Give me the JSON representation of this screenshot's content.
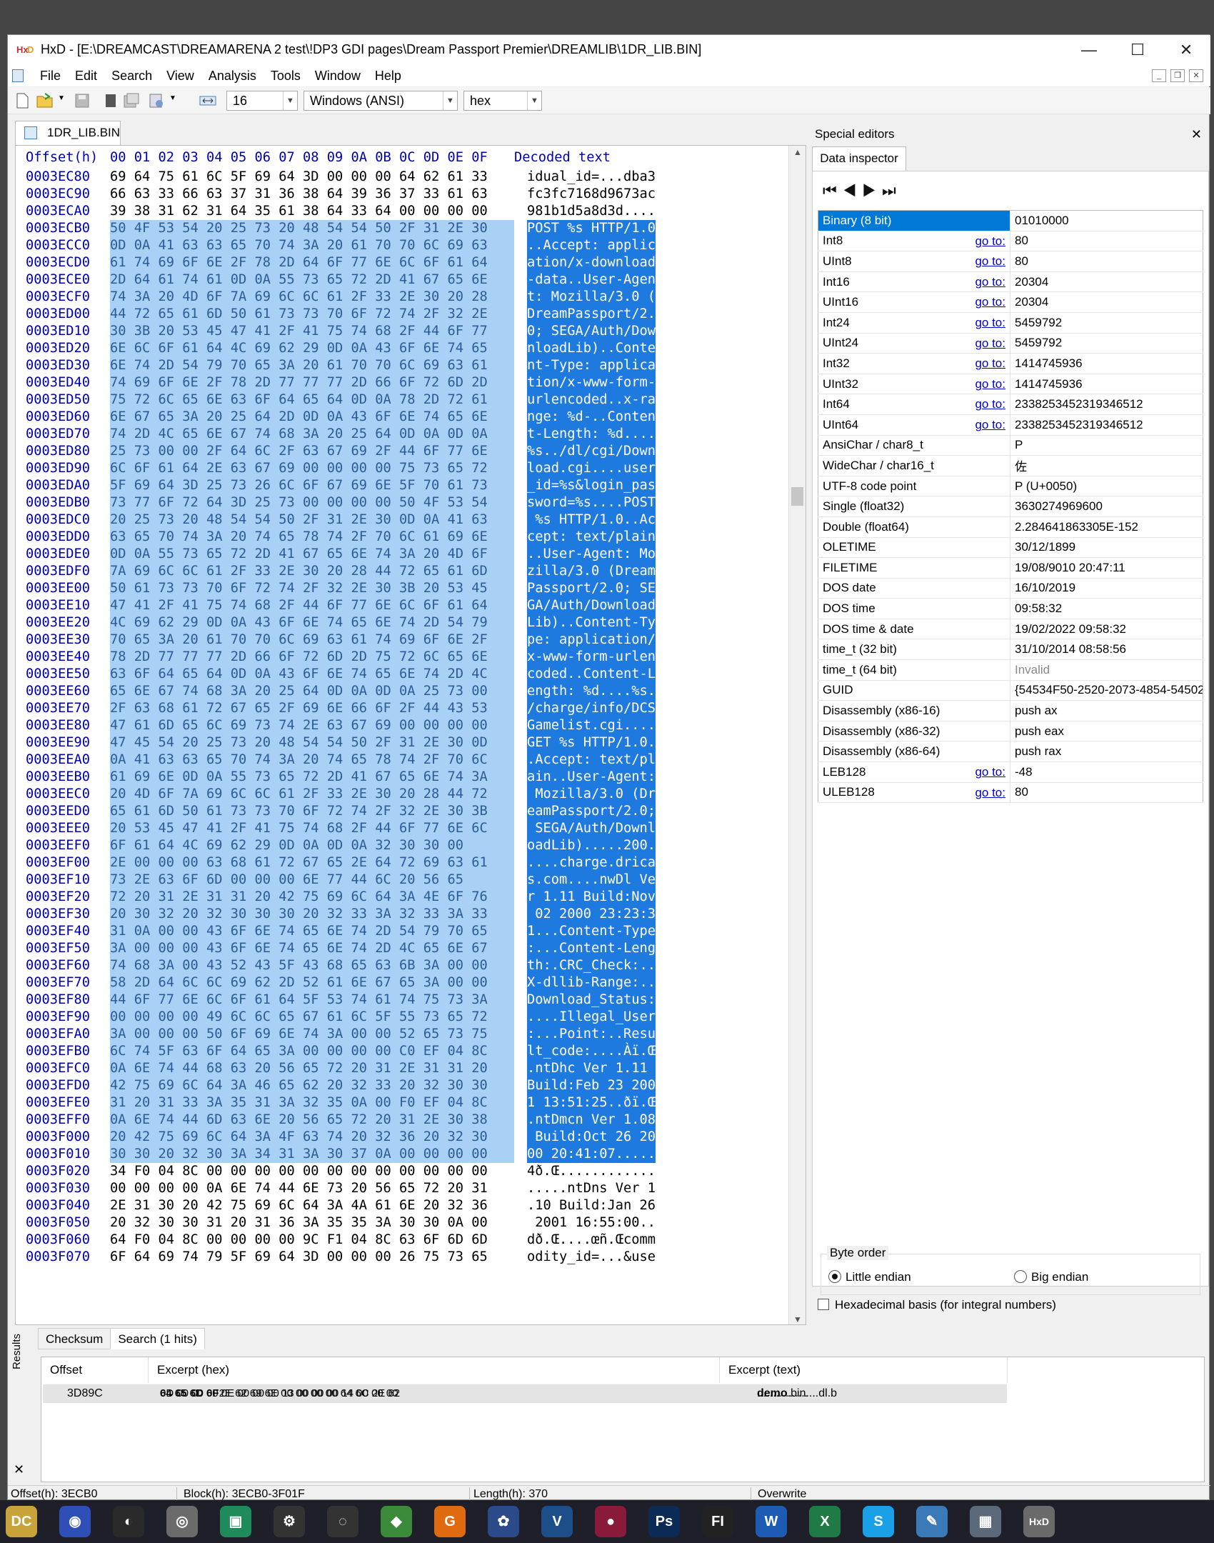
{
  "window": {
    "title": "HxD - [E:\\DREAMCAST\\DREAMARENA 2 test\\!DP3 GDI pages\\Dream Passport Premier\\DREAMLIB\\1DR_LIB.BIN]",
    "minimize_glyph": "—",
    "maximize_glyph": "☐",
    "close_glyph": "✕"
  },
  "menu": [
    "File",
    "Edit",
    "Search",
    "View",
    "Analysis",
    "Tools",
    "Window",
    "Help"
  ],
  "toolbar": {
    "bytes_per_row": "16",
    "charset": "Windows (ANSI)",
    "offset_base": "hex"
  },
  "document_tab": "1DR_LIB.BIN",
  "hex": {
    "header_offset": "Offset(h)",
    "header_columns": "00 01 02 03 04 05 06 07 08 09 0A 0B 0C 0D 0E 0F",
    "header_decoded": "Decoded text",
    "rows": [
      {
        "o": "0003EC80",
        "h": "69 64 75 61 6C 5F 69 64 3D 00 00 00 64 62 61 33",
        "t": "idual_id=...dba3",
        "s": false
      },
      {
        "o": "0003EC90",
        "h": "66 63 33 66 63 37 31 36 38 64 39 36 37 33 61 63",
        "t": "fc3fc7168d9673ac",
        "s": false
      },
      {
        "o": "0003ECA0",
        "h": "39 38 31 62 31 64 35 61 38 64 33 64 00 00 00 00",
        "t": "981b1d5a8d3d....",
        "s": false
      },
      {
        "o": "0003ECB0",
        "h": "50 4F 53 54 20 25 73 20 48 54 54 50 2F 31 2E 30",
        "t": "POST %s HTTP/1.0",
        "s": true
      },
      {
        "o": "0003ECC0",
        "h": "0D 0A 41 63 63 65 70 74 3A 20 61 70 70 6C 69 63",
        "t": "..Accept: applic",
        "s": true
      },
      {
        "o": "0003ECD0",
        "h": "61 74 69 6F 6E 2F 78 2D 64 6F 77 6E 6C 6F 61 64",
        "t": "ation/x-download",
        "s": true
      },
      {
        "o": "0003ECE0",
        "h": "2D 64 61 74 61 0D 0A 55 73 65 72 2D 41 67 65 6E",
        "t": "-data..User-Agen",
        "s": true
      },
      {
        "o": "0003ECF0",
        "h": "74 3A 20 4D 6F 7A 69 6C 6C 61 2F 33 2E 30 20 28",
        "t": "t: Mozilla/3.0 (",
        "s": true
      },
      {
        "o": "0003ED00",
        "h": "44 72 65 61 6D 50 61 73 73 70 6F 72 74 2F 32 2E",
        "t": "DreamPassport/2.",
        "s": true
      },
      {
        "o": "0003ED10",
        "h": "30 3B 20 53 45 47 41 2F 41 75 74 68 2F 44 6F 77",
        "t": "0; SEGA/Auth/Dow",
        "s": true
      },
      {
        "o": "0003ED20",
        "h": "6E 6C 6F 61 64 4C 69 62 29 0D 0A 43 6F 6E 74 65",
        "t": "nloadLib)..Conte",
        "s": true
      },
      {
        "o": "0003ED30",
        "h": "6E 74 2D 54 79 70 65 3A 20 61 70 70 6C 69 63 61",
        "t": "nt-Type: applica",
        "s": true
      },
      {
        "o": "0003ED40",
        "h": "74 69 6F 6E 2F 78 2D 77 77 77 2D 66 6F 72 6D 2D",
        "t": "tion/x-www-form-",
        "s": true
      },
      {
        "o": "0003ED50",
        "h": "75 72 6C 65 6E 63 6F 64 65 64 0D 0A 78 2D 72 61",
        "t": "urlencoded..x-ra",
        "s": true
      },
      {
        "o": "0003ED60",
        "h": "6E 67 65 3A 20 25 64 2D 0D 0A 43 6F 6E 74 65 6E",
        "t": "nge: %d-..Conten",
        "s": true
      },
      {
        "o": "0003ED70",
        "h": "74 2D 4C 65 6E 67 74 68 3A 20 25 64 0D 0A 0D 0A",
        "t": "t-Length: %d....",
        "s": true
      },
      {
        "o": "0003ED80",
        "h": "25 73 00 00 2F 64 6C 2F 63 67 69 2F 44 6F 77 6E",
        "t": "%s../dl/cgi/Down",
        "s": true
      },
      {
        "o": "0003ED90",
        "h": "6C 6F 61 64 2E 63 67 69 00 00 00 00 75 73 65 72",
        "t": "load.cgi....user",
        "s": true
      },
      {
        "o": "0003EDA0",
        "h": "5F 69 64 3D 25 73 26 6C 6F 67 69 6E 5F 70 61 73",
        "t": "_id=%s&login_pas",
        "s": true
      },
      {
        "o": "0003EDB0",
        "h": "73 77 6F 72 64 3D 25 73 00 00 00 00 50 4F 53 54",
        "t": "sword=%s....POST",
        "s": true
      },
      {
        "o": "0003EDC0",
        "h": "20 25 73 20 48 54 54 50 2F 31 2E 30 0D 0A 41 63",
        "t": " %s HTTP/1.0..Ac",
        "s": true
      },
      {
        "o": "0003EDD0",
        "h": "63 65 70 74 3A 20 74 65 78 74 2F 70 6C 61 69 6E",
        "t": "cept: text/plain",
        "s": true
      },
      {
        "o": "0003EDE0",
        "h": "0D 0A 55 73 65 72 2D 41 67 65 6E 74 3A 20 4D 6F",
        "t": "..User-Agent: Mo",
        "s": true
      },
      {
        "o": "0003EDF0",
        "h": "7A 69 6C 6C 61 2F 33 2E 30 20 28 44 72 65 61 6D",
        "t": "zilla/3.0 (Dream",
        "s": true
      },
      {
        "o": "0003EE00",
        "h": "50 61 73 73 70 6F 72 74 2F 32 2E 30 3B 20 53 45",
        "t": "Passport/2.0; SE",
        "s": true
      },
      {
        "o": "0003EE10",
        "h": "47 41 2F 41 75 74 68 2F 44 6F 77 6E 6C 6F 61 64",
        "t": "GA/Auth/Download",
        "s": true
      },
      {
        "o": "0003EE20",
        "h": "4C 69 62 29 0D 0A 43 6F 6E 74 65 6E 74 2D 54 79",
        "t": "Lib)..Content-Ty",
        "s": true
      },
      {
        "o": "0003EE30",
        "h": "70 65 3A 20 61 70 70 6C 69 63 61 74 69 6F 6E 2F",
        "t": "pe: application/",
        "s": true
      },
      {
        "o": "0003EE40",
        "h": "78 2D 77 77 77 2D 66 6F 72 6D 2D 75 72 6C 65 6E",
        "t": "x-www-form-urlen",
        "s": true
      },
      {
        "o": "0003EE50",
        "h": "63 6F 64 65 64 0D 0A 43 6F 6E 74 65 6E 74 2D 4C",
        "t": "coded..Content-L",
        "s": true
      },
      {
        "o": "0003EE60",
        "h": "65 6E 67 74 68 3A 20 25 64 0D 0A 0D 0A 25 73 00",
        "t": "ength: %d....%s.",
        "s": true
      },
      {
        "o": "0003EE70",
        "h": "2F 63 68 61 72 67 65 2F 69 6E 66 6F 2F 44 43 53",
        "t": "/charge/info/DCS",
        "s": true
      },
      {
        "o": "0003EE80",
        "h": "47 61 6D 65 6C 69 73 74 2E 63 67 69 00 00 00 00",
        "t": "Gamelist.cgi....",
        "s": true
      },
      {
        "o": "0003EE90",
        "h": "47 45 54 20 25 73 20 48 54 54 50 2F 31 2E 30 0D",
        "t": "GET %s HTTP/1.0.",
        "s": true
      },
      {
        "o": "0003EEA0",
        "h": "0A 41 63 63 65 70 74 3A 20 74 65 78 74 2F 70 6C",
        "t": ".Accept: text/pl",
        "s": true
      },
      {
        "o": "0003EEB0",
        "h": "61 69 6E 0D 0A 55 73 65 72 2D 41 67 65 6E 74 3A",
        "t": "ain..User-Agent:",
        "s": true
      },
      {
        "o": "0003EEC0",
        "h": "20 4D 6F 7A 69 6C 6C 61 2F 33 2E 30 20 28 44 72",
        "t": " Mozilla/3.0 (Dr",
        "s": true
      },
      {
        "o": "0003EED0",
        "h": "65 61 6D 50 61 73 73 70 6F 72 74 2F 32 2E 30 3B",
        "t": "eamPassport/2.0;",
        "s": true
      },
      {
        "o": "0003EEE0",
        "h": "20 53 45 47 41 2F 41 75 74 68 2F 44 6F 77 6E 6C",
        "t": " SEGA/Auth/Downl",
        "s": true
      },
      {
        "o": "0003EEF0",
        "h": "6F 61 64 4C 69 62 29 0D 0A 0D 0A 32 30 30 00",
        "t": "oadLib).....200.",
        "s": true
      },
      {
        "o": "0003EF00",
        "h": "2E 00 00 00 63 68 61 72 67 65 2E 64 72 69 63 61",
        "t": "....charge.drica",
        "s": true
      },
      {
        "o": "0003EF10",
        "h": "73 2E 63 6F 6D 00 00 00 6E 77 44 6C 20 56 65",
        "t": "s.com....nwDl Ve",
        "s": true
      },
      {
        "o": "0003EF20",
        "h": "72 20 31 2E 31 31 20 42 75 69 6C 64 3A 4E 6F 76",
        "t": "r 1.11 Build:Nov",
        "s": true
      },
      {
        "o": "0003EF30",
        "h": "20 30 32 20 32 30 30 30 20 32 33 3A 32 33 3A 33",
        "t": " 02 2000 23:23:3",
        "s": true
      },
      {
        "o": "0003EF40",
        "h": "31 0A 00 00 43 6F 6E 74 65 6E 74 2D 54 79 70 65",
        "t": "1...Content-Type",
        "s": true
      },
      {
        "o": "0003EF50",
        "h": "3A 00 00 00 43 6F 6E 74 65 6E 74 2D 4C 65 6E 67",
        "t": ":...Content-Leng",
        "s": true
      },
      {
        "o": "0003EF60",
        "h": "74 68 3A 00 43 52 43 5F 43 68 65 63 6B 3A 00 00",
        "t": "th:.CRC_Check:..",
        "s": true
      },
      {
        "o": "0003EF70",
        "h": "58 2D 64 6C 6C 69 62 2D 52 61 6E 67 65 3A 00 00",
        "t": "X-dllib-Range:..",
        "s": true
      },
      {
        "o": "0003EF80",
        "h": "44 6F 77 6E 6C 6F 61 64 5F 53 74 61 74 75 73 3A",
        "t": "Download_Status:",
        "s": true
      },
      {
        "o": "0003EF90",
        "h": "00 00 00 00 49 6C 6C 65 67 61 6C 5F 55 73 65 72",
        "t": "....Illegal_User",
        "s": true
      },
      {
        "o": "0003EFA0",
        "h": "3A 00 00 00 50 6F 69 6E 74 3A 00 00 52 65 73 75",
        "t": ":...Point:..Resu",
        "s": true
      },
      {
        "o": "0003EFB0",
        "h": "6C 74 5F 63 6F 64 65 3A 00 00 00 00 C0 EF 04 8C",
        "t": "lt_code:....Àï.Œ",
        "s": true
      },
      {
        "o": "0003EFC0",
        "h": "0A 6E 74 44 68 63 20 56 65 72 20 31 2E 31 31 20",
        "t": ".ntDhc Ver 1.11 ",
        "s": true
      },
      {
        "o": "0003EFD0",
        "h": "42 75 69 6C 64 3A 46 65 62 20 32 33 20 32 30 30",
        "t": "Build:Feb 23 200",
        "s": true
      },
      {
        "o": "0003EFE0",
        "h": "31 20 31 33 3A 35 31 3A 32 35 0A 00 F0 EF 04 8C",
        "t": "1 13:51:25..ðï.Œ",
        "s": true
      },
      {
        "o": "0003EFF0",
        "h": "0A 6E 74 44 6D 63 6E 20 56 65 72 20 31 2E 30 38",
        "t": ".ntDmcn Ver 1.08",
        "s": true
      },
      {
        "o": "0003F000",
        "h": "20 42 75 69 6C 64 3A 4F 63 74 20 32 36 20 32 30",
        "t": " Build:Oct 26 20",
        "s": true
      },
      {
        "o": "0003F010",
        "h": "30 30 20 32 30 3A 34 31 3A 30 37 0A 00 00 00 00",
        "t": "00 20:41:07.....",
        "s": true
      },
      {
        "o": "0003F020",
        "h": "34 F0 04 8C 00 00 00 00 00 00 00 00 00 00 00 00",
        "t": "4ð.Œ............",
        "s": false
      },
      {
        "o": "0003F030",
        "h": "00 00 00 00 0A 6E 74 44 6E 73 20 56 65 72 20 31",
        "t": ".....ntDns Ver 1",
        "s": false
      },
      {
        "o": "0003F040",
        "h": "2E 31 30 20 42 75 69 6C 64 3A 4A 61 6E 20 32 36",
        "t": ".10 Build:Jan 26",
        "s": false
      },
      {
        "o": "0003F050",
        "h": "20 32 30 30 31 20 31 36 3A 35 35 3A 30 30 0A 00",
        "t": " 2001 16:55:00..",
        "s": false
      },
      {
        "o": "0003F060",
        "h": "64 F0 04 8C 00 00 00 00 9C F1 04 8C 63 6F 6D 6D",
        "t": "dð.Œ....œñ.Œcomm",
        "s": false
      },
      {
        "o": "0003F070",
        "h": "6F 64 69 74 79 5F 69 64 3D 00 00 00 26 75 73 65",
        "t": "odity_id=...&use",
        "s": false
      }
    ]
  },
  "special_editors": {
    "title": "Special editors",
    "tab": "Data inspector",
    "nav": "⏮◀▶⏭",
    "goto_label": "go to:",
    "rows": [
      {
        "name": "Binary (8 bit)",
        "value": "01010000",
        "goto": false,
        "hl": true
      },
      {
        "name": "Int8",
        "value": "80",
        "goto": true
      },
      {
        "name": "UInt8",
        "value": "80",
        "goto": true
      },
      {
        "name": "Int16",
        "value": "20304",
        "goto": true
      },
      {
        "name": "UInt16",
        "value": "20304",
        "goto": true
      },
      {
        "name": "Int24",
        "value": "5459792",
        "goto": true
      },
      {
        "name": "UInt24",
        "value": "5459792",
        "goto": true
      },
      {
        "name": "Int32",
        "value": "1414745936",
        "goto": true
      },
      {
        "name": "UInt32",
        "value": "1414745936",
        "goto": true
      },
      {
        "name": "Int64",
        "value": "2338253452319346512",
        "goto": true
      },
      {
        "name": "UInt64",
        "value": "2338253452319346512",
        "goto": true
      },
      {
        "name": "AnsiChar / char8_t",
        "value": "P",
        "goto": false
      },
      {
        "name": "WideChar / char16_t",
        "value": "佐",
        "goto": false
      },
      {
        "name": "UTF-8 code point",
        "value": "P (U+0050)",
        "goto": false
      },
      {
        "name": "Single (float32)",
        "value": "3630274969600",
        "goto": false
      },
      {
        "name": "Double (float64)",
        "value": "2.284641863305E-152",
        "goto": false
      },
      {
        "name": "OLETIME",
        "value": "30/12/1899",
        "goto": false
      },
      {
        "name": "FILETIME",
        "value": "19/08/9010 20:47:11",
        "goto": false
      },
      {
        "name": "DOS date",
        "value": "16/10/2019",
        "goto": false
      },
      {
        "name": "DOS time",
        "value": "09:58:32",
        "goto": false
      },
      {
        "name": "DOS time & date",
        "value": "19/02/2022 09:58:32",
        "goto": false
      },
      {
        "name": "time_t (32 bit)",
        "value": "31/10/2014 08:58:56",
        "goto": false
      },
      {
        "name": "time_t (64 bit)",
        "value": "Invalid",
        "goto": false,
        "invalid": true
      },
      {
        "name": "GUID",
        "value": "{54534F50-2520-2073-4854-54502",
        "goto": false
      },
      {
        "name": "Disassembly (x86-16)",
        "value": "push ax",
        "goto": false
      },
      {
        "name": "Disassembly (x86-32)",
        "value": "push eax",
        "goto": false
      },
      {
        "name": "Disassembly (x86-64)",
        "value": "push rax",
        "goto": false
      },
      {
        "name": "LEB128",
        "value": "-48",
        "goto": true
      },
      {
        "name": "ULEB128",
        "value": "80",
        "goto": true
      }
    ],
    "byte_order_label": "Byte order",
    "little_endian": "Little endian",
    "big_endian": "Big endian",
    "hex_basis": "Hexadecimal basis (for integral numbers)"
  },
  "results": {
    "side_label": "Results",
    "tab_checksum": "Checksum",
    "tab_search": "Search (1 hits)",
    "col_offset": "Offset",
    "col_excerpt_hex": "Excerpt (hex)",
    "col_excerpt_text": "Excerpt (text)",
    "row": {
      "offset": "3D89C",
      "hex_pre": "0D 00 00 00 0E 00 00 00 13 00 00 00 14 00 00 00 ",
      "hex_match": "64 65 6D 6F",
      "hex_post": " 2E 62 69 6E 00 00 00 00 64 6C 2E 62",
      "text_pre": "................",
      "text_match": "demo",
      "text_post": ".bin....dl.b"
    },
    "close_glyph": "✕"
  },
  "status": {
    "offset": "Offset(h): 3ECB0",
    "block": "Block(h): 3ECB0-3F01F",
    "length": "Length(h): 370",
    "mode": "Overwrite"
  },
  "taskbar": [
    {
      "name": "app-dreamcast",
      "label": "DC",
      "color": "#c7a33a"
    },
    {
      "name": "app-fire",
      "label": "◉",
      "color": "#2e4fb8"
    },
    {
      "name": "app-steam",
      "label": "◐",
      "color": "#2a2a2a"
    },
    {
      "name": "app-disc",
      "label": "◎",
      "color": "#6b6b6b"
    },
    {
      "name": "app-green",
      "label": "▣",
      "color": "#1f8a5a"
    },
    {
      "name": "app-gear",
      "label": "⚙",
      "color": "#333"
    },
    {
      "name": "app-obs",
      "label": "◌",
      "color": "#333"
    },
    {
      "name": "app-layers",
      "label": "◆",
      "color": "#3a8a3a"
    },
    {
      "name": "app-g",
      "label": "G",
      "color": "#e06a10"
    },
    {
      "name": "app-resolve",
      "label": "✿",
      "color": "#2a4a8a"
    },
    {
      "name": "app-vegas",
      "label": "V",
      "color": "#1c4f8a"
    },
    {
      "name": "app-record",
      "label": "●",
      "color": "#8a1a3a"
    },
    {
      "name": "app-photoshop",
      "label": "Ps",
      "color": "#0b2a55"
    },
    {
      "name": "app-fl",
      "label": "FI",
      "color": "#222"
    },
    {
      "name": "app-word",
      "label": "W",
      "color": "#1e5bb5"
    },
    {
      "name": "app-excel",
      "label": "X",
      "color": "#1f7a45"
    },
    {
      "name": "app-skype",
      "label": "S",
      "color": "#1aa0e6"
    },
    {
      "name": "app-pen",
      "label": "✎",
      "color": "#3a7ab8"
    },
    {
      "name": "app-calculator",
      "label": "▦",
      "color": "#5a6a7a"
    },
    {
      "name": "app-hxd",
      "label": "HxD",
      "color": "#6a6a6a"
    }
  ]
}
